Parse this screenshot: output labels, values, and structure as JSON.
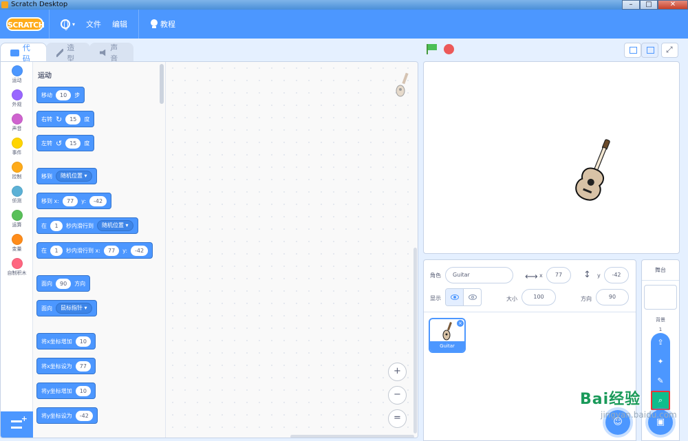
{
  "window": {
    "title": "Scratch Desktop",
    "minimize": "–",
    "maximize": "□",
    "close": "✕"
  },
  "menu": {
    "logo": "SCRATCH",
    "language_caret": "▾",
    "file": "文件",
    "edit": "编辑",
    "tutorials": "教程"
  },
  "tabs": [
    {
      "label": "代码",
      "icon": "code-icon",
      "active": true
    },
    {
      "label": "造型",
      "icon": "brush-icon",
      "active": false
    },
    {
      "label": "声音",
      "icon": "sound-icon",
      "active": false
    }
  ],
  "categories": [
    {
      "label": "运动",
      "color": "#4c97ff"
    },
    {
      "label": "外观",
      "color": "#9966ff"
    },
    {
      "label": "声音",
      "color": "#cf63cf"
    },
    {
      "label": "事件",
      "color": "#ffd500"
    },
    {
      "label": "控制",
      "color": "#ffab19"
    },
    {
      "label": "侦测",
      "color": "#5cb1d6"
    },
    {
      "label": "运算",
      "color": "#59c059"
    },
    {
      "label": "变量",
      "color": "#ff8c1a"
    },
    {
      "label": "自制积木",
      "color": "#ff6680"
    }
  ],
  "palette": {
    "section_title": "运动",
    "blocks": {
      "move": {
        "pre": "移动",
        "val": "10",
        "post": "步"
      },
      "turn_right": {
        "pre": "右转",
        "icon": "↻",
        "val": "15",
        "post": "度"
      },
      "turn_left": {
        "pre": "左转",
        "icon": "↺",
        "val": "15",
        "post": "度"
      },
      "goto": {
        "pre": "移到",
        "drop": "随机位置 ▾"
      },
      "goto_xy": {
        "pre": "移到 x:",
        "x": "77",
        "ylbl": "y:",
        "y": "-42"
      },
      "glide_to": {
        "pre": "在",
        "secs": "1",
        "mid": "秒内滑行到",
        "drop": "随机位置 ▾"
      },
      "glide_xy": {
        "pre": "在",
        "secs": "1",
        "mid": "秒内滑行到 x:",
        "x": "77",
        "ylbl": "y:",
        "y": "-42"
      },
      "point_dir": {
        "pre": "面向",
        "val": "90",
        "post": "方向"
      },
      "point_towards": {
        "pre": "面向",
        "drop": "鼠标指针 ▾"
      },
      "change_x": {
        "pre": "将x坐标增加",
        "val": "10"
      },
      "set_x": {
        "pre": "将x坐标设为",
        "val": "77"
      },
      "change_y": {
        "pre": "将y坐标增加",
        "val": "10"
      },
      "set_y": {
        "pre": "将y坐标设为",
        "val": "-42"
      }
    }
  },
  "zoom": {
    "in": "+",
    "out": "−",
    "reset": "="
  },
  "sprite_info": {
    "sprite_label": "角色",
    "sprite_name": "Guitar",
    "x_label": "x",
    "x": "77",
    "y_label": "y",
    "y": "-42",
    "show_label": "显示",
    "size_label": "大小",
    "size": "100",
    "direction_label": "方向",
    "direction": "90"
  },
  "sprites": [
    {
      "name": "Guitar",
      "delete": "×"
    }
  ],
  "stage_pane": {
    "title": "舞台",
    "backdrop_label": "背景",
    "backdrop_count": "1"
  },
  "fab": {
    "upload": "⇪",
    "surprise": "✦",
    "paint": "✎",
    "search": "⌕",
    "main": "▣"
  },
  "watermark": {
    "logo": "Bai经验",
    "sub": "jingyan.baidu.com"
  }
}
